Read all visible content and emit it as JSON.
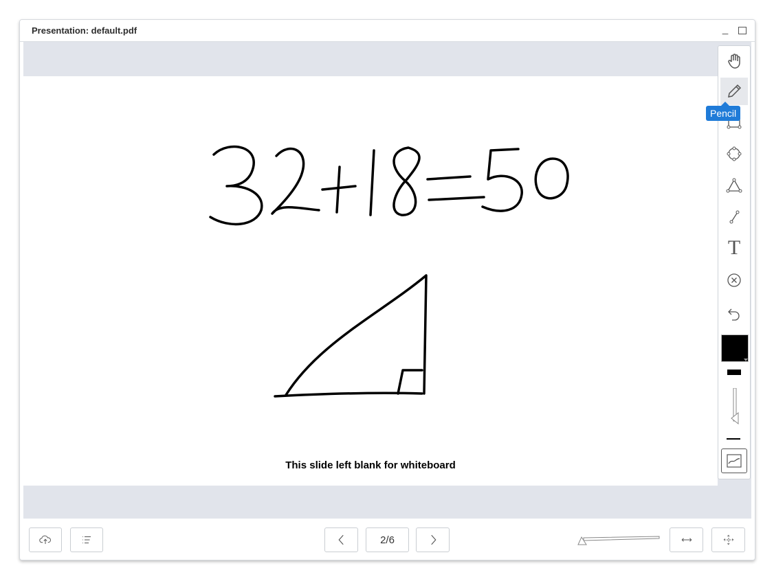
{
  "window": {
    "title": "Presentation: default.pdf"
  },
  "slide": {
    "caption": "This slide left blank for whiteboard",
    "handwriting": "32+18=50"
  },
  "toolbar": {
    "tools": [
      {
        "name": "hand",
        "icon": "hand-icon"
      },
      {
        "name": "pencil",
        "icon": "pencil-icon",
        "active": true
      },
      {
        "name": "rectangle",
        "icon": "rectangle-icon"
      },
      {
        "name": "ellipse",
        "icon": "ellipse-icon"
      },
      {
        "name": "triangle",
        "icon": "triangle-icon"
      },
      {
        "name": "line",
        "icon": "line-icon"
      },
      {
        "name": "text",
        "icon": "text-icon",
        "glyph": "T"
      },
      {
        "name": "clear",
        "icon": "clear-icon"
      },
      {
        "name": "undo",
        "icon": "undo-icon"
      }
    ],
    "tooltip": "Pencil",
    "color": "#000000"
  },
  "bottom": {
    "page_indicator": "2/6"
  },
  "colors": {
    "tooltip_bg": "#1f7bd8",
    "slide_bg": "#e1e4eb"
  }
}
